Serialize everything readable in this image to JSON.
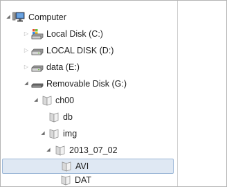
{
  "tree": {
    "computer": {
      "label": "Computer",
      "icon": "computer-icon",
      "expanded": true
    },
    "local_c": {
      "label": "Local Disk (C:)",
      "icon": "system-drive-icon",
      "expanded": false
    },
    "local_d": {
      "label": "LOCAL DISK (D:)",
      "icon": "hard-drive-icon",
      "expanded": false
    },
    "data_e": {
      "label": "data (E:)",
      "icon": "hard-drive-icon",
      "expanded": false
    },
    "removable_g": {
      "label": "Removable Disk (G:)",
      "icon": "removable-drive-icon",
      "expanded": true
    },
    "ch00": {
      "label": "ch00",
      "icon": "folder-icon",
      "expanded": true
    },
    "db": {
      "label": "db",
      "icon": "folder-icon"
    },
    "img": {
      "label": "img",
      "icon": "folder-icon",
      "expanded": true
    },
    "date_folder": {
      "label": "2013_07_02",
      "icon": "folder-icon",
      "expanded": true
    },
    "avi": {
      "label": "AVI",
      "icon": "folder-icon",
      "selected": true
    },
    "dat": {
      "label": "DAT",
      "icon": "folder-icon"
    }
  },
  "colors": {
    "selection_bg": "#dfe8f3",
    "selection_border": "#9db8d8"
  }
}
